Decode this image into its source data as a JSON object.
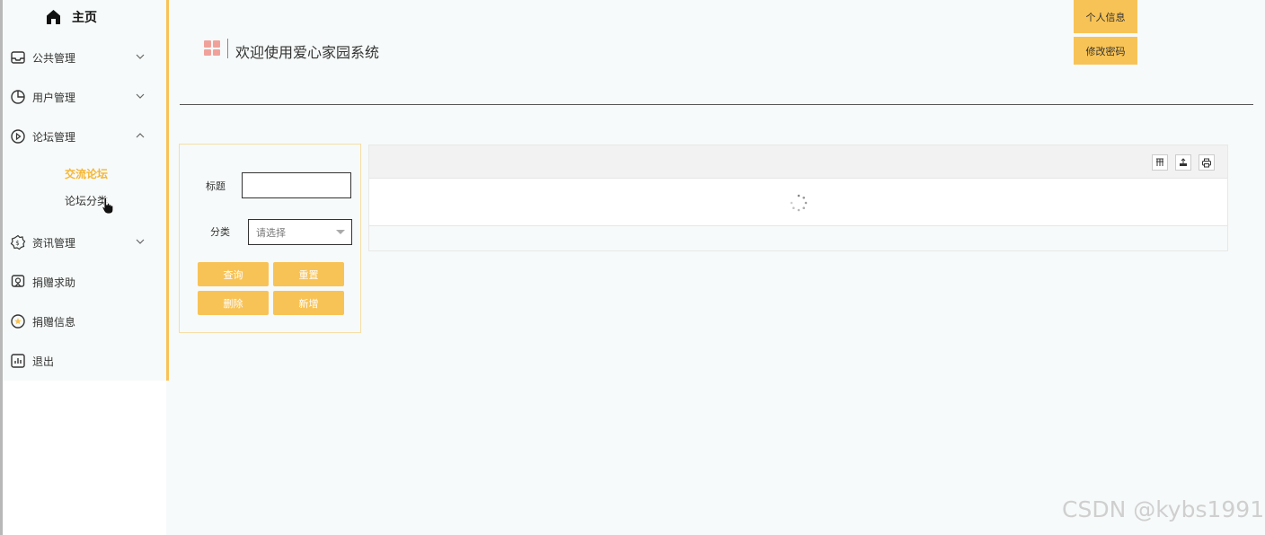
{
  "sidebar": {
    "home_label": "主页",
    "items": [
      {
        "label": "公共管理"
      },
      {
        "label": "用户管理"
      },
      {
        "label": "论坛管理"
      },
      {
        "label": "资讯管理"
      },
      {
        "label": "捐赠求助"
      },
      {
        "label": "捐赠信息"
      },
      {
        "label": "退出"
      }
    ],
    "forum_sub": [
      {
        "label": "交流论坛"
      },
      {
        "label": "论坛分类"
      }
    ],
    "active_sub": "交流论坛"
  },
  "header": {
    "title": "欢迎使用爱心家园系统",
    "profile_button": "个人信息",
    "password_button": "修改密码"
  },
  "search": {
    "title_label": "标题",
    "title_value": "",
    "category_label": "分类",
    "category_placeholder": "请选择",
    "query_button": "查询",
    "reset_button": "重置",
    "delete_button": "删除",
    "add_button": "新增"
  },
  "watermark": "CSDN @kybs1991",
  "colors": {
    "accent": "#f8c356",
    "active_text": "#f5b632",
    "logo": "#f0a29a"
  }
}
